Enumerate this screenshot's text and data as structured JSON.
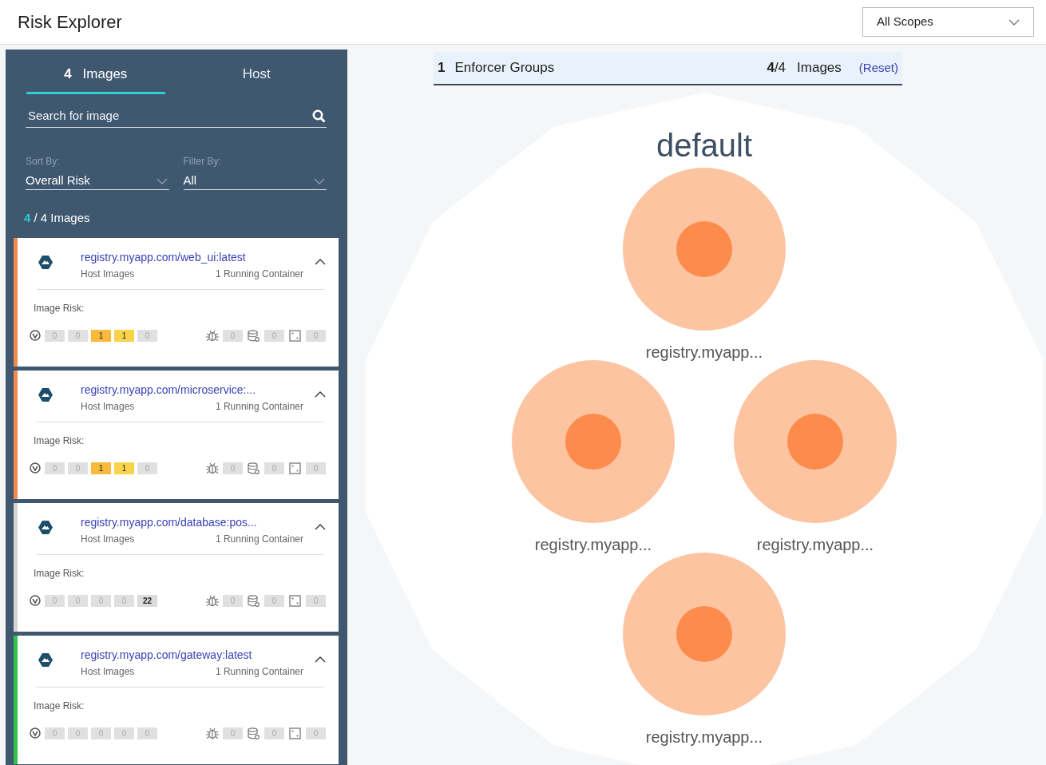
{
  "header": {
    "title": "Risk Explorer",
    "scope": "All Scopes"
  },
  "sidebar": {
    "tabs": [
      {
        "count": "4",
        "label": "Images",
        "selected": true
      },
      {
        "label": "Host",
        "selected": false
      }
    ],
    "search": {
      "placeholder": "Search for image"
    },
    "sort": {
      "label": "Sort By:",
      "value": "Overall Risk"
    },
    "filter": {
      "label": "Filter By:",
      "value": "All"
    },
    "count": {
      "shown": "4",
      "rest": "/ 4 Images"
    },
    "images": [
      {
        "name": "registry.myapp.com/web_ui:latest",
        "type": "Host Images",
        "containers": "1 Running Container",
        "expanded": true,
        "color": "#f58a4b",
        "risk_label": "Image Risk:",
        "severities": [
          {
            "value": "0",
            "kind": "critical"
          },
          {
            "value": "0",
            "kind": "high"
          },
          {
            "value": "1",
            "kind": "medium"
          },
          {
            "value": "1",
            "kind": "low"
          },
          {
            "value": "0",
            "kind": "negligible"
          }
        ],
        "malware": "0",
        "sensitive": "0",
        "other": "0"
      },
      {
        "name": "registry.myapp.com/microservice:...",
        "type": "Host Images",
        "containers": "1 Running Container",
        "expanded": true,
        "color": "#f58a4b",
        "risk_label": "Image Risk:",
        "severities": [
          {
            "value": "0",
            "kind": "critical"
          },
          {
            "value": "0",
            "kind": "high"
          },
          {
            "value": "1",
            "kind": "medium"
          },
          {
            "value": "1",
            "kind": "low"
          },
          {
            "value": "0",
            "kind": "negligible"
          }
        ],
        "malware": "0",
        "sensitive": "0",
        "other": "0"
      },
      {
        "name": "registry.myapp.com/database:pos...",
        "type": "Host Images",
        "containers": "1 Running Container",
        "expanded": true,
        "color": "#d4d4d4",
        "risk_label": "Image Risk:",
        "severities": [
          {
            "value": "0",
            "kind": "critical"
          },
          {
            "value": "0",
            "kind": "high"
          },
          {
            "value": "0",
            "kind": "medium"
          },
          {
            "value": "0",
            "kind": "low"
          },
          {
            "value": "22",
            "kind": "negligible"
          }
        ],
        "malware": "0",
        "sensitive": "0",
        "other": "0"
      },
      {
        "name": "registry.myapp.com/gateway:latest",
        "type": "Host Images",
        "containers": "1 Running Container",
        "expanded": true,
        "color": "#2fc64a",
        "risk_label": "Image Risk:",
        "severities": [
          {
            "value": "0",
            "kind": "critical"
          },
          {
            "value": "0",
            "kind": "high"
          },
          {
            "value": "0",
            "kind": "medium"
          },
          {
            "value": "0",
            "kind": "low"
          },
          {
            "value": "0",
            "kind": "negligible"
          }
        ],
        "malware": "0",
        "sensitive": "0",
        "other": "0"
      }
    ]
  },
  "graph": {
    "summary": {
      "groups_count": "1",
      "groups_label": "Enforcer Groups",
      "images_shown": "4",
      "images_total": "/4",
      "images_label": "Images",
      "reset": "(Reset)"
    },
    "group": {
      "name": "default",
      "nodes": [
        {
          "label": "registry.myapp..."
        },
        {
          "label": "registry.myapp..."
        },
        {
          "label": "registry.myapp..."
        },
        {
          "label": "registry.myapp..."
        }
      ]
    }
  }
}
